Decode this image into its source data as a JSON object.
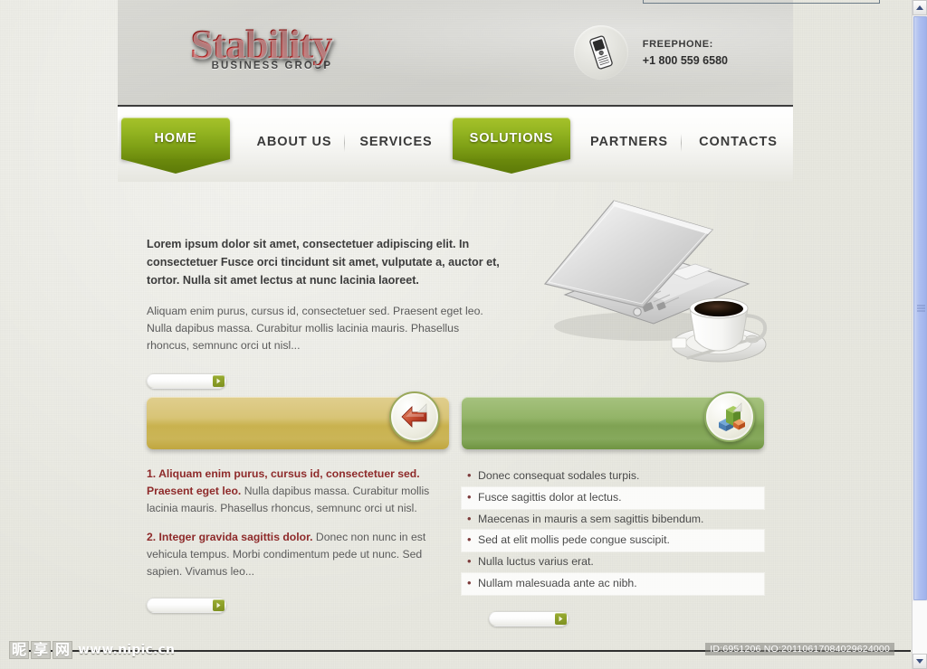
{
  "site": {
    "logo": {
      "brand": "Stability",
      "tagline": "BUSINESS GROUP"
    },
    "contact": {
      "icon": "mobile-phone-icon",
      "label": "FREEPHONE:",
      "number": "+1 800 559 6580"
    }
  },
  "nav": {
    "items": [
      {
        "label": "HOME",
        "active": true
      },
      {
        "label": "ABOUT US",
        "active": false
      },
      {
        "label": "SERVICES",
        "active": false
      },
      {
        "label": "SOLUTIONS",
        "active": true
      },
      {
        "label": "PARTNERS",
        "active": false
      },
      {
        "label": "CONTACTS",
        "active": false
      }
    ]
  },
  "hero": {
    "lead": "Lorem ipsum dolor sit amet, consectetuer adipiscing elit. In consectetuer Fusce orci  tincidunt sit amet, vulputate a, auctor et, tortor. Nulla sit amet lectus at nunc lacinia laoreet.",
    "body": "Aliquam enim purus, cursus id, consectetuer sed. Praesent eget leo. Nulla dapibus massa. Curabitur mollis lacinia mauris. Phasellus rhoncus, semnunc orci ut nisl...",
    "image_alt": "laptop-and-coffee-photo",
    "readmore_label": ""
  },
  "banners": [
    {
      "name": "gold-banner",
      "color": "#cbb557",
      "icon": "red-arrow-page-icon",
      "label": ""
    },
    {
      "name": "green-banner",
      "color": "#86a95c",
      "icon": "bar-chart-cube-icon",
      "label": ""
    }
  ],
  "columns": {
    "left": {
      "paragraphs": [
        {
          "bold": "1. Aliquam enim purus, cursus id, consectetuer sed. Praesent eget leo.",
          "rest": " Nulla dapibus massa. Curabitur mollis lacinia mauris. Phasellus rhoncus, semnunc orci ut nisl."
        },
        {
          "bold": "2. Integer gravida sagittis dolor.",
          "rest": " Donec non nunc in est vehicula tempus. Morbi condimentum pede ut nunc. Sed sapien. Vivamus leo..."
        }
      ],
      "readmore_label": ""
    },
    "right": {
      "items": [
        "Donec consequat sodales turpis.",
        "Fusce sagittis dolor at lectus.",
        "Maecenas in mauris a sem sagittis bibendum.",
        "Sed at elit mollis pede congue suscipit.",
        "Nulla luctus varius erat.",
        "Nullam malesuada ante ac nibh."
      ],
      "readmore_label": ""
    }
  },
  "watermark": {
    "logo_chars": [
      "昵",
      "享",
      "网"
    ],
    "url": "www.nipic.cn",
    "id_text": "ID:6951206 NO:20110617084029624000"
  },
  "scrollbar": {
    "up_icon": "chevron-up-icon",
    "down_icon": "chevron-down-icon"
  }
}
